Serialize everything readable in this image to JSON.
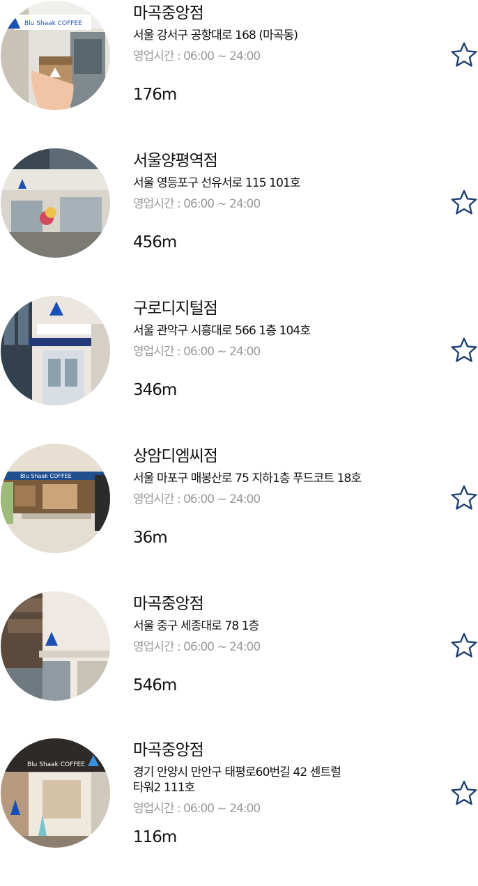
{
  "stores": [
    {
      "name": "마곡중앙점",
      "address": "서울 강서구 공항대로 168 (마곡동)",
      "hours": "영업시간 : 06:00 ~ 24:00",
      "distance": "176m",
      "photo_sign": "Blu Shaak COFFEE",
      "favorite_icon": "star-outline-icon"
    },
    {
      "name": "서울양평역점",
      "address": "서울 영등포구 선유서로 115 101호",
      "hours": "영업시간 : 06:00 ~ 24:00",
      "distance": "456m",
      "photo_sign": "",
      "favorite_icon": "star-outline-icon"
    },
    {
      "name": "구로디지털점",
      "address": "서울 관악구 시흥대로 566 1층 104호",
      "hours": "영업시간 : 06:00 ~ 24:00",
      "distance": "346m",
      "photo_sign": "",
      "favorite_icon": "star-outline-icon"
    },
    {
      "name": "상암디엠씨점",
      "address": "서울 마포구 매봉산로 75 지하1층 푸드코트 18호",
      "hours": "영업시간 : 06:00 ~ 24:00",
      "distance": "36m",
      "photo_sign": "Blu Shaak COFFEE",
      "favorite_icon": "star-outline-icon"
    },
    {
      "name": "마곡중앙점",
      "address": "서울 중구 세종대로 78 1층",
      "hours": "영업시간 : 06:00 ~ 24:00",
      "distance": "546m",
      "photo_sign": "",
      "favorite_icon": "star-outline-icon"
    },
    {
      "name": "마곡중앙점",
      "address": "경기 안양시 만안구 태평로60번길 42 센트럴타워2 111호",
      "hours": "영업시간 : 06:00 ~ 24:00",
      "distance": "116m",
      "photo_sign": "Blu Shaak COFFEE",
      "favorite_icon": "star-outline-icon"
    }
  ],
  "colors": {
    "text": "#111111",
    "muted": "#9a9a9a",
    "star_stroke": "#1f3f73",
    "brand_blue": "#1a4fb5",
    "wall": "#d8d2c8"
  }
}
